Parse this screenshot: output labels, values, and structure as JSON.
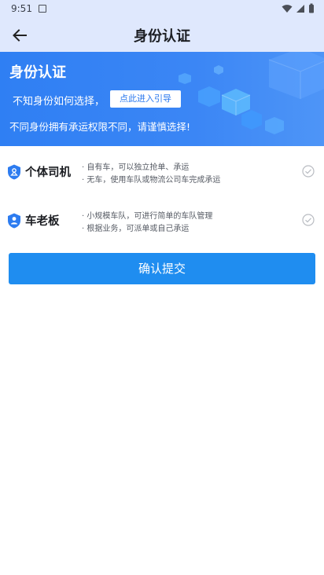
{
  "status_bar": {
    "time": "9:51"
  },
  "header": {
    "title": "身份认证"
  },
  "banner": {
    "title": "身份认证",
    "question": "不知身份如何选择，",
    "guide_button": "点此进入引导",
    "note": "不同身份拥有承运权限不同，请谨慎选择!"
  },
  "roles": [
    {
      "name": "个体司机",
      "desc": [
        "· 自有车，可以独立抢单、承运",
        "· 无车，使用车队或物流公司车完成承运"
      ]
    },
    {
      "name": "车老板",
      "desc": [
        "· 小规模车队，可进行简单的车队管理",
        "· 根据业务，可派单或自己承运"
      ]
    }
  ],
  "submit_label": "确认提交",
  "colors": {
    "accent": "#1f8df0",
    "banner": "#2f7ff3",
    "header_bg": "#dfe8fd"
  }
}
